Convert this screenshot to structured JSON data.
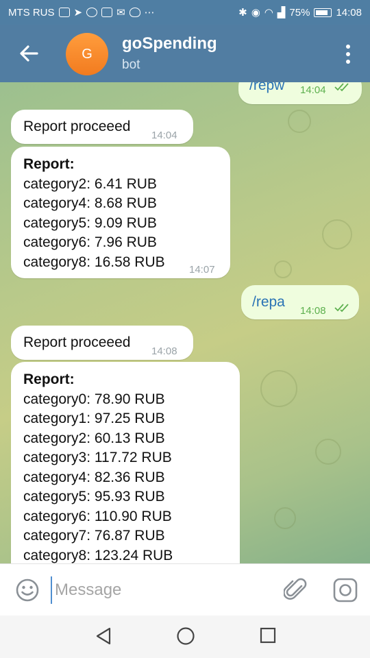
{
  "status": {
    "carrier": "MTS RUS",
    "battery": "75%",
    "time": "14:08"
  },
  "header": {
    "avatar_letter": "G",
    "title": "goSpending",
    "subtitle": "bot"
  },
  "messages": {
    "m1": {
      "text": "/repw",
      "time": "14:04"
    },
    "m2": {
      "text": "Report proceeed",
      "time": "14:04"
    },
    "m3": {
      "title": "Report:",
      "lines": [
        "category2: 6.41 RUB",
        "category4: 8.68 RUB",
        "category5: 9.09 RUB",
        "category6: 7.96 RUB",
        "category8: 16.58 RUB"
      ],
      "time": "14:07"
    },
    "m4": {
      "text": "/repa",
      "time": "14:08"
    },
    "m5": {
      "text": "Report proceeed",
      "time": "14:08"
    },
    "m6": {
      "title": "Report:",
      "lines": [
        "category0: 78.90 RUB",
        "category1: 97.25 RUB",
        "category2: 60.13 RUB",
        "category3: 117.72 RUB",
        "category4: 82.36 RUB",
        "category5: 95.93 RUB",
        "category6: 110.90 RUB",
        "category7: 76.87 RUB",
        "category8: 123.24 RUB"
      ]
    }
  },
  "input": {
    "placeholder": "Message"
  },
  "colors": {
    "header": "#517da2",
    "outgoing_bubble": "#effdde",
    "check_color": "#5db04e"
  }
}
